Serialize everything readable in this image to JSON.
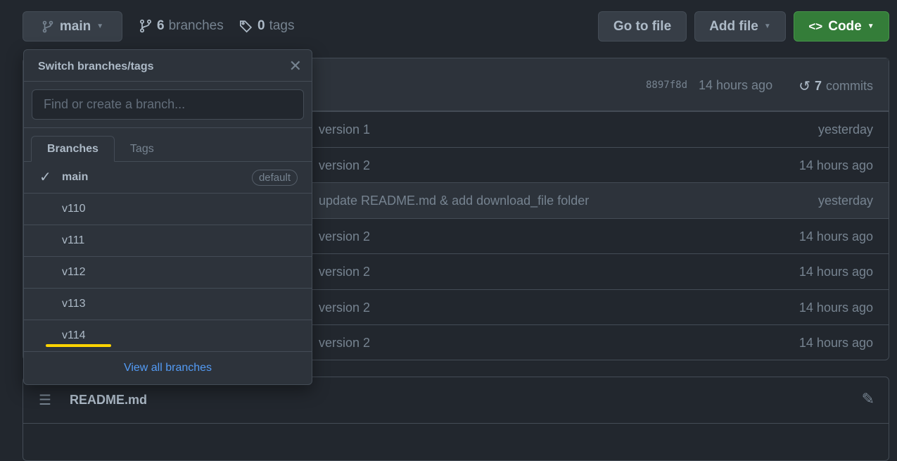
{
  "toolbar": {
    "branch": "main",
    "branches_count": "6",
    "branches_label": "branches",
    "tags_count": "0",
    "tags_label": "tags",
    "go_to_file": "Go to file",
    "add_file": "Add file",
    "code": "Code"
  },
  "latest": {
    "sha": "8897f8d",
    "age": "14 hours ago",
    "commits_count": "7",
    "commits_label": "commits"
  },
  "files": [
    {
      "message": "version 1",
      "age": "yesterday"
    },
    {
      "message": "version 2",
      "age": "14 hours ago"
    },
    {
      "message": "update README.md & add download_file folder",
      "age": "yesterday"
    },
    {
      "message": "version 2",
      "age": "14 hours ago"
    },
    {
      "message": "version 2",
      "age": "14 hours ago"
    },
    {
      "message": "version 2",
      "age": "14 hours ago"
    },
    {
      "message": "version 2",
      "age": "14 hours ago"
    }
  ],
  "dropdown": {
    "title": "Switch branches/tags",
    "placeholder": "Find or create a branch...",
    "tabs": [
      "Branches",
      "Tags"
    ],
    "branches": [
      {
        "name": "main",
        "badge": "default"
      },
      {
        "name": "v110"
      },
      {
        "name": "v111"
      },
      {
        "name": "v112"
      },
      {
        "name": "v113"
      },
      {
        "name": "v114"
      }
    ],
    "view_all": "View all branches"
  },
  "readme": {
    "title": "README.md"
  },
  "colors": {
    "accent": "#347d39",
    "highlight": "#ffd400",
    "link": "#539bf5"
  }
}
